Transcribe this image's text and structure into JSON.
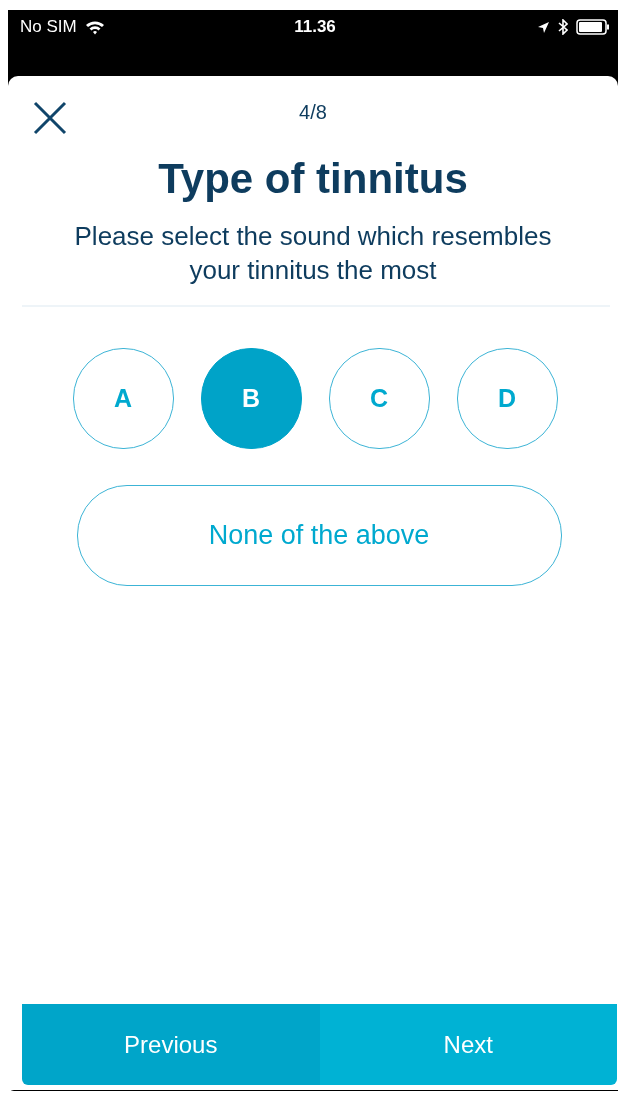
{
  "status_bar": {
    "carrier": "No SIM",
    "time": "11.36"
  },
  "header": {
    "progress": "4/8"
  },
  "title": "Type of tinnitus",
  "prompt": "Please select the sound which resembles your tinnitus the most",
  "options": [
    {
      "label": "A",
      "selected": false
    },
    {
      "label": "B",
      "selected": true
    },
    {
      "label": "C",
      "selected": false
    },
    {
      "label": "D",
      "selected": false
    }
  ],
  "none_option": {
    "label": "None of the above",
    "selected": false
  },
  "buttons": [
    {
      "label": "Previous",
      "kind": "previous"
    },
    {
      "label": "Next",
      "kind": "next"
    }
  ]
}
